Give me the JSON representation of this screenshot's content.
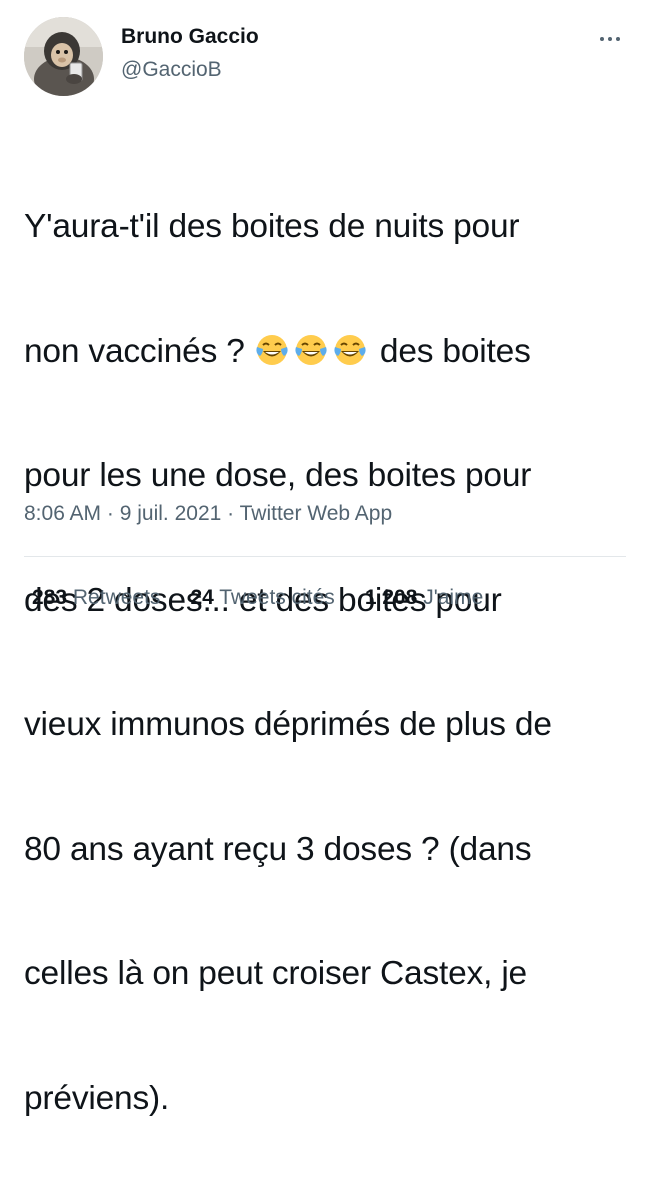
{
  "author": {
    "name": "Bruno Gaccio",
    "handle": "@GaccioB",
    "avatar_icon": "monkey-with-phone-avatar"
  },
  "more_icon": "more-options-icon",
  "tweet": {
    "lines": [
      "Y'aura-t'il des boites de nuits pour",
      "non vaccinés ?",
      "des boites",
      "pour les une dose, des boites pour",
      "des 2 doses... et des boites pour",
      "vieux immunos déprimés de plus de",
      "80 ans ayant reçu 3 doses ? (dans",
      "celles là on peut croiser Castex, je",
      "préviens)."
    ],
    "emoji_name": "face-with-tears-of-joy-emoji",
    "emoji_count": 3
  },
  "meta": {
    "time": "8:06 AM",
    "separator": " · ",
    "date": "9 juil. 2021",
    "source": "Twitter Web App"
  },
  "stats": {
    "retweets_count": "283",
    "retweets_label": "Retweets",
    "quotes_count": "24",
    "quotes_label": "Tweets cités",
    "likes_count": "1 208",
    "likes_label": "J'aime"
  },
  "colors": {
    "text_primary": "#0f1419",
    "text_secondary": "#536471",
    "divider": "#e3e7ea"
  }
}
